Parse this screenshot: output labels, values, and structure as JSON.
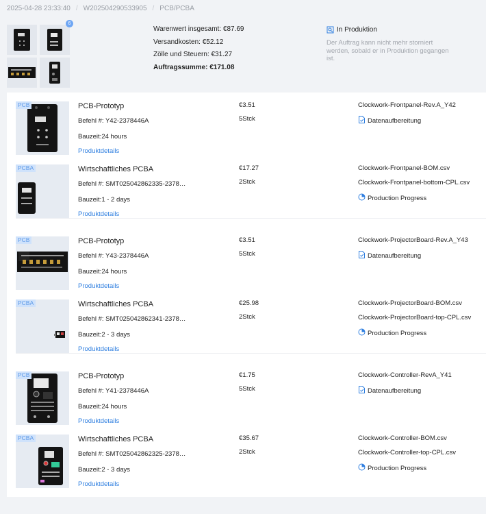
{
  "breadcrumb": [
    "2025-04-28 23:33:40",
    "W202504290533905",
    "PCB/PCBA"
  ],
  "thumb_count": "6",
  "totals": {
    "goods": "Warenwert insgesamt: €87.69",
    "shipping": "Versandkosten: €52.12",
    "tax": "Zölle und Steuern: €31.27",
    "total": "Auftragssumme: €171.08"
  },
  "status": {
    "label": "In Produktion",
    "note": "Der Auftrag kann nicht mehr storniert werden, sobald er in Produktion gegangen ist."
  },
  "colors": {
    "accent": "#2f7fe0",
    "tag_bg": "#cfe2fb",
    "board": "#141414"
  },
  "link_label": "Produktdetails",
  "items": [
    {
      "tag": "PCB",
      "title": "PCB-Prototyp",
      "order": "Befehl #: Y42-2378446A",
      "build_time": "Bauzeit:24 hours",
      "price": "€3.51",
      "qty": "5Stck",
      "files": [
        "Clockwork-Frontpanel-Rev.A_Y42"
      ],
      "status_icon": "data-prep-icon",
      "status_text": "Datenaufbereitung"
    },
    {
      "tag": "PCBA",
      "title": "Wirtschaftliches PCBA",
      "order": "Befehl #: SMT025042862335-23784…",
      "build_time": "Bauzeit:1 - 2 days",
      "price": "€17.27",
      "qty": "2Stck",
      "files": [
        "Clockwork-Frontpanel-BOM.csv",
        "Clockwork-Frontpanel-bottom-CPL.csv"
      ],
      "status_icon": "progress-icon",
      "status_text": "Production Progress"
    },
    {
      "tag": "PCB",
      "title": "PCB-Prototyp",
      "order": "Befehl #: Y43-2378446A",
      "build_time": "Bauzeit:24 hours",
      "price": "€3.51",
      "qty": "5Stck",
      "files": [
        "Clockwork-ProjectorBoard-Rev.A_Y43"
      ],
      "status_icon": "data-prep-icon",
      "status_text": "Datenaufbereitung"
    },
    {
      "tag": "PCBA",
      "title": "Wirtschaftliches PCBA",
      "order": "Befehl #: SMT025042862341-23784…",
      "build_time": "Bauzeit:2 - 3 days",
      "price": "€25.98",
      "qty": "2Stck",
      "files": [
        "Clockwork-ProjectorBoard-BOM.csv",
        "Clockwork-ProjectorBoard-top-CPL.csv"
      ],
      "status_icon": "progress-icon",
      "status_text": "Production Progress"
    },
    {
      "tag": "PCB",
      "title": "PCB-Prototyp",
      "order": "Befehl #: Y41-2378446A",
      "build_time": "Bauzeit:24 hours",
      "price": "€1.75",
      "qty": "5Stck",
      "files": [
        "Clockwork-Controller-RevA_Y41"
      ],
      "status_icon": "data-prep-icon",
      "status_text": "Datenaufbereitung"
    },
    {
      "tag": "PCBA",
      "title": "Wirtschaftliches PCBA",
      "order": "Befehl #: SMT025042862325-23784…",
      "build_time": "Bauzeit:2 - 3 days",
      "price": "€35.67",
      "qty": "2Stck",
      "files": [
        "Clockwork-Controller-BOM.csv",
        "Clockwork-Controller-top-CPL.csv"
      ],
      "status_icon": "progress-icon",
      "status_text": "Production Progress"
    }
  ]
}
